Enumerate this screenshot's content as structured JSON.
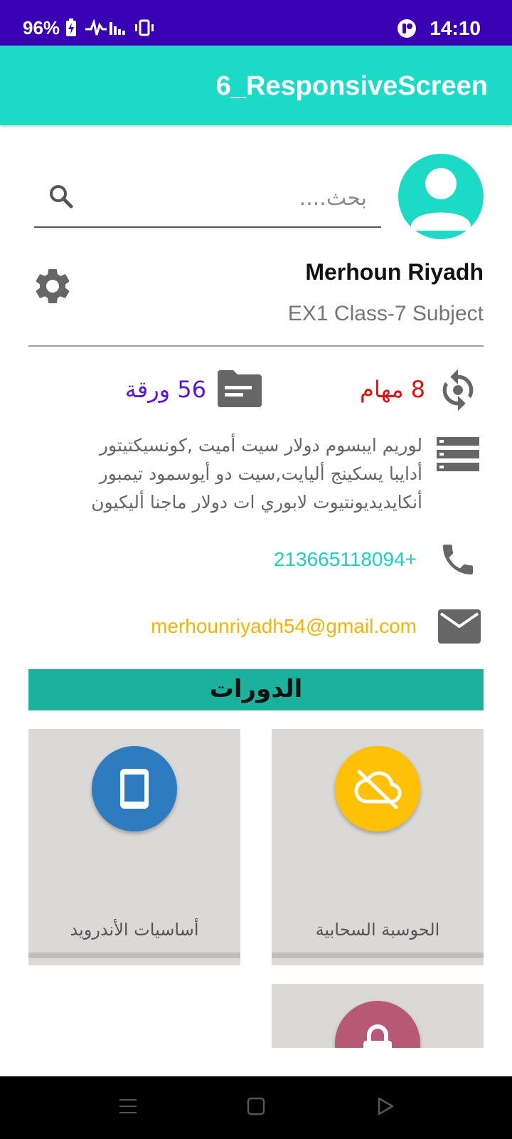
{
  "status_bar": {
    "battery": "96%",
    "time": "14:10"
  },
  "app_bar": {
    "title": "6_ResponsiveScreen"
  },
  "search": {
    "placeholder": "بحث...."
  },
  "profile": {
    "name": "Merhoun Riyadh",
    "subtitle": "EX1 Class-7 Subject"
  },
  "stats": {
    "tasks": "8 مهام",
    "papers": "56 ورقة"
  },
  "description": {
    "line1": "لوريم ايبسوم دولار سيت أميت ,كونسيكتيتور",
    "line2": "أدايبا يسكينج أليايت,سيت دو أيوسمود تيمبور",
    "line3": "أنكايديديونتيوت لابوري ات دولار ماجنا أليكيون"
  },
  "contact": {
    "phone": "213665118094+",
    "email": "merhounriyadh54@gmail.com"
  },
  "courses": {
    "header": "الدورات",
    "items": [
      {
        "label": "أساسيات الأندرويد",
        "icon": "phone-android-icon",
        "color": "#2f7bc0"
      },
      {
        "label": "الحوسبة السحابية",
        "icon": "cloud-off-icon",
        "color": "#ffc107"
      },
      {
        "label": "",
        "icon": "lock-icon",
        "color": "#b85877"
      }
    ]
  },
  "colors": {
    "status_bar": "#3a00b3",
    "app_bar": "#1ddac7",
    "courses_header": "#1bb19c",
    "tasks": "#e01010",
    "papers": "#5b14e0",
    "phone": "#1ccfc0",
    "email": "#f4b400"
  }
}
